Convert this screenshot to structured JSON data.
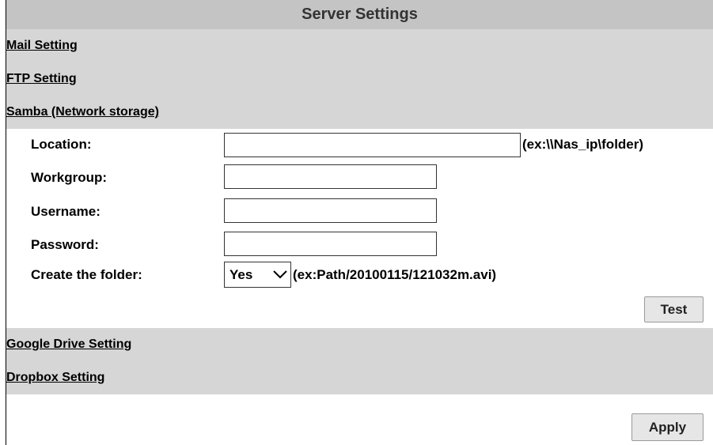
{
  "header": {
    "title": "Server Settings"
  },
  "sections": {
    "mail": "Mail Setting",
    "ftp": "FTP Setting",
    "samba": "Samba (Network storage)",
    "google": "Google Drive Setting",
    "dropbox": "Dropbox Setting"
  },
  "samba_form": {
    "location_label": "Location:",
    "location_value": "",
    "location_hint": "(ex:\\\\Nas_ip\\folder)",
    "workgroup_label": "Workgroup:",
    "workgroup_value": "",
    "username_label": "Username:",
    "username_value": "",
    "password_label": "Password:",
    "password_value": "",
    "create_folder_label": "Create the folder:",
    "create_folder_value": "Yes",
    "create_folder_hint": "(ex:Path/20100115/121032m.avi)",
    "test_button": "Test"
  },
  "footer": {
    "apply_button": "Apply"
  },
  "icons": {
    "dropdown": "chevron-down-icon"
  },
  "colors": {
    "title_bar": "#c4c4c4",
    "section_band": "#d6d6d6"
  }
}
